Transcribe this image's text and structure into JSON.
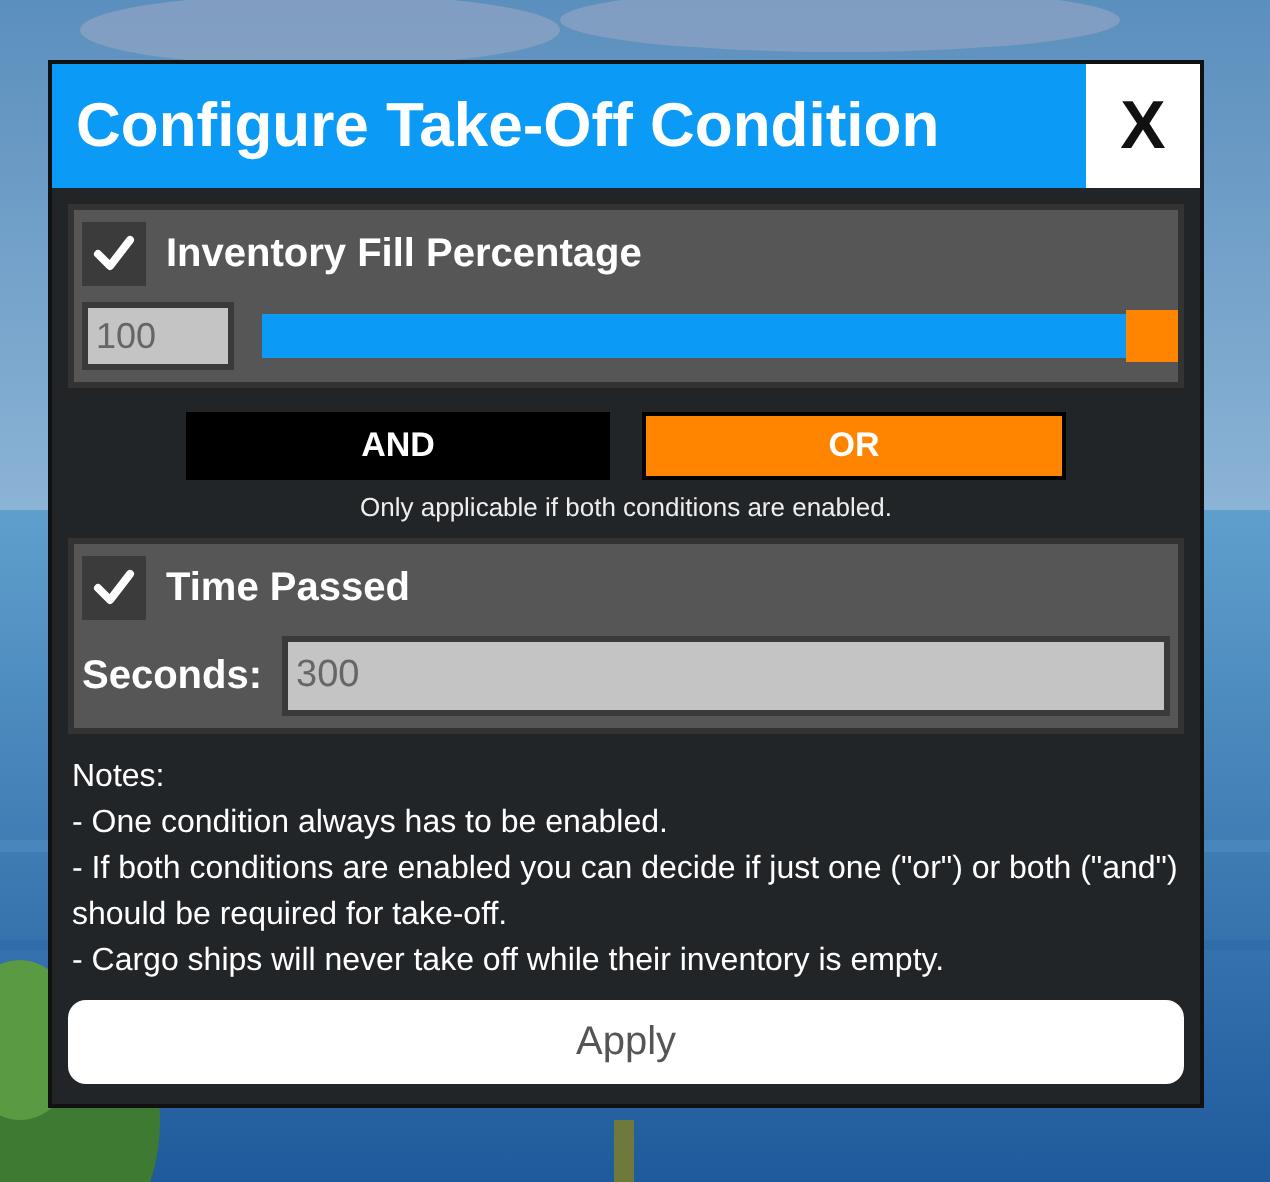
{
  "window": {
    "title": "Configure Take-Off Condition",
    "close": "X"
  },
  "fill_condition": {
    "label": "Inventory Fill Percentage",
    "checked": true,
    "value": "100",
    "level": 1
  },
  "logic": {
    "options": [
      {
        "label": "AND",
        "selected": false
      },
      {
        "label": "OR",
        "selected": true
      }
    ],
    "hint": "Only applicable if both conditions are enabled."
  },
  "time_condition": {
    "label": "Time Passed",
    "checked": true,
    "field_label": "Seconds:",
    "value": "300"
  },
  "notes": {
    "title": "Notes:",
    "lines": [
      "- One condition always has to be enabled.",
      "- If both conditions are enabled you can decide if just one (\"or\") or both (\"and\") should be required for take-off.",
      "- Cargo ships will never take off while their inventory is empty."
    ]
  },
  "apply": "Apply"
}
